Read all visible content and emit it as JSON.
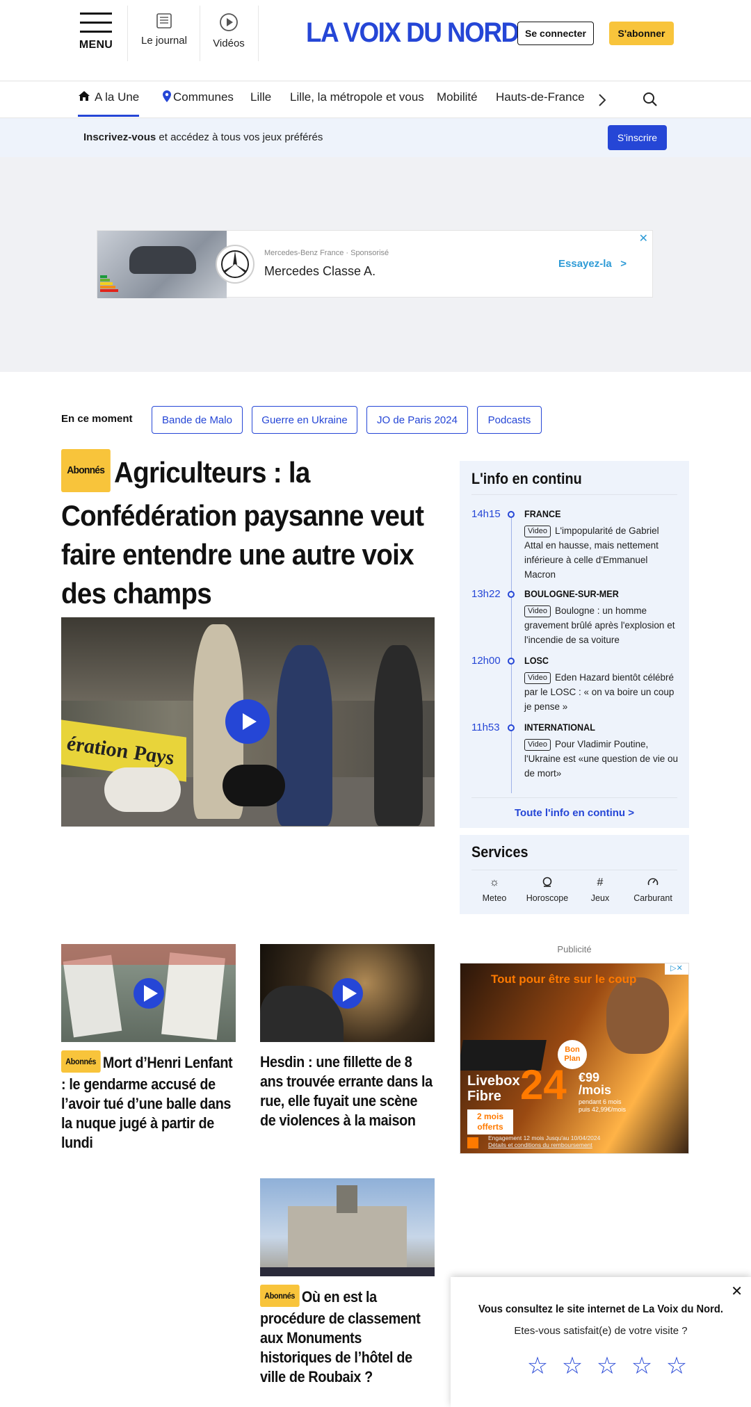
{
  "header": {
    "menu_label": "MENU",
    "journal_label": "Le journal",
    "videos_label": "Vidéos",
    "logo_text": "LA VOIX DU NORD",
    "login_label": "Se connecter",
    "subscribe_label": "S'abonner"
  },
  "nav": {
    "items": [
      "A la Une",
      "Communes",
      "Lille",
      "Lille, la métropole et vous",
      "Mobilité",
      "Hauts-de-France"
    ],
    "active_index": 0
  },
  "signup_bar": {
    "bold": "Inscrivez-vous",
    "text": " et accédez à tous vos jeux préférés",
    "button": "S'inscrire"
  },
  "ad": {
    "sponsor": "Mercedes-Benz France",
    "sponsor_suffix": " · Sponsorisé",
    "title": "Mercedes Classe A.",
    "cta": "Essayez-la",
    "cta_arrow": ">"
  },
  "moment": {
    "label": "En ce moment",
    "chips": [
      "Bande de Malo",
      "Guerre en Ukraine",
      "JO de Paris 2024",
      "Podcasts"
    ]
  },
  "main_story": {
    "badge": "Abonnés",
    "title": "Agriculteurs : la Confédération paysanne veut faire entendre une autre voix des champs",
    "image_text": "ération Pays"
  },
  "live": {
    "title": "L'info en continu",
    "video_label": "Video",
    "entries": [
      {
        "time": "14h15",
        "category": "FRANCE",
        "text": "L'impopularité de Gabriel Attal en hausse, mais nettement inférieure à celle d'Emmanuel Macron"
      },
      {
        "time": "13h22",
        "category": "BOULOGNE-SUR-MER",
        "text": "Boulogne : un homme gravement brûlé après l'explosion et l'incendie de sa voiture"
      },
      {
        "time": "12h00",
        "category": "LOSC",
        "text": "Eden Hazard bientôt célébré par le LOSC : « on va boire un coup je pense »"
      },
      {
        "time": "11h53",
        "category": "INTERNATIONAL",
        "text": "Pour Vladimir Poutine, l'Ukraine est «une question de vie ou de mort»"
      }
    ],
    "more": "Toute l'info en continu >"
  },
  "services": {
    "title": "Services",
    "items": [
      {
        "label": "Meteo",
        "icon": "sun-icon"
      },
      {
        "label": "Horoscope",
        "icon": "horoscope-icon"
      },
      {
        "label": "Jeux",
        "icon": "hash-icon"
      },
      {
        "label": "Carburant",
        "icon": "fuel-gauge-icon"
      }
    ]
  },
  "stories": [
    {
      "badge": "Abonnés",
      "title": "Mort d’Henri Lenfant : le gendarme accusé de l’avoir tué d’une balle dans la nuque jugé à partir de lundi",
      "has_video": true
    },
    {
      "badge": "",
      "title": "Hesdin : une fillette de 8 ans trouvée errante dans la rue, elle fuyait une scène de violences à la maison",
      "has_video": true
    },
    {
      "badge": "Abonnés",
      "title": "Où en est la procédure de classement aux Monuments historiques de l’hôtel de ville de Roubaix ?",
      "has_video": false
    }
  ],
  "pub": {
    "label": "Publicité",
    "line1_highlight": "Tout",
    "line1": " pour être sur le coup",
    "product": "Livebox Fibre",
    "offer": "2 mois offerts",
    "price": "24",
    "cents": "€99 /mois",
    "small": "pendant 6 mois puis 42,99€/mois",
    "bon_plan": "Bon Plan",
    "engagement": "Engagement 12 mois Jusqu'au 10/04/2024",
    "conditions": "Détails et conditions du remboursement"
  },
  "survey": {
    "question": "Vous consultez le site internet de La Voix du Nord.",
    "subquestion": "Etes-vous satisfait(e) de votre visite ?",
    "stars": 5
  },
  "colors": {
    "brand_blue": "#2546d6",
    "subscribe_yellow": "#f8c43b",
    "panel_bg": "#eef3fb"
  }
}
